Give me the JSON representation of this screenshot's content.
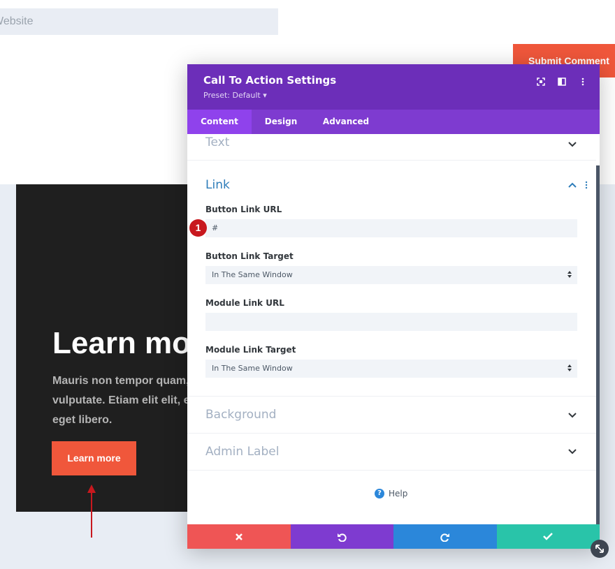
{
  "page": {
    "website_placeholder": "Website",
    "submit_label": "Submit Comment",
    "cta": {
      "title": "Learn more",
      "body_lines": [
        "Mauris non tempor quam, et lacinia sapien.",
        "vulputate. Etiam elit elit, elementum sed",
        "eget libero."
      ],
      "button_label": "Learn more"
    }
  },
  "modal": {
    "title": "Call To Action Settings",
    "preset": "Preset: Default ▾",
    "tabs": [
      {
        "label": "Content",
        "active": true
      },
      {
        "label": "Design",
        "active": false
      },
      {
        "label": "Advanced",
        "active": false
      }
    ],
    "sections": {
      "text": "Text",
      "link": "Link",
      "background": "Background",
      "admin_label": "Admin Label"
    },
    "fields": {
      "button_link_url_label": "Button Link URL",
      "button_link_url_value": "#",
      "button_link_target_label": "Button Link Target",
      "button_link_target_value": "In The Same Window",
      "module_link_url_label": "Module Link URL",
      "module_link_url_value": "",
      "module_link_target_label": "Module Link Target",
      "module_link_target_value": "In The Same Window"
    },
    "badge_number": "1",
    "help_label": "Help",
    "footer_icons": [
      "close-icon",
      "undo-icon",
      "redo-icon",
      "check-icon"
    ]
  },
  "colors": {
    "header_purple": "#6c2eb9",
    "tab_purple": "#7e3bd0",
    "accent_orange": "#f0573b",
    "cancel_red": "#ef5555",
    "undo_purple": "#7e3bd0",
    "redo_blue": "#2b87da",
    "save_green": "#29c4a9"
  }
}
